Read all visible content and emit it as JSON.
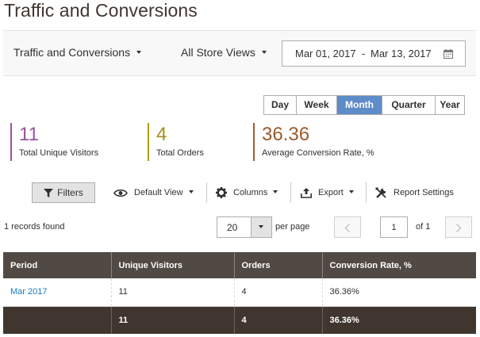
{
  "page": {
    "title": "Traffic and Conversions"
  },
  "toolbar": {
    "report_select": "Traffic and Conversions",
    "store_select": "All Store Views",
    "date_from": "Mar 01, 2017",
    "date_separator": "-",
    "date_to": "Mar 13, 2017"
  },
  "period_tabs": [
    {
      "label": "Day",
      "active": false
    },
    {
      "label": "Week",
      "active": false
    },
    {
      "label": "Month",
      "active": true
    },
    {
      "label": "Quarter",
      "active": false
    },
    {
      "label": "Year",
      "active": false
    }
  ],
  "metrics": [
    {
      "value": "11",
      "label": "Total Unique Visitors",
      "color": "#9a53a0"
    },
    {
      "value": "4",
      "label": "Total Orders",
      "color": "#b29c14"
    },
    {
      "value": "36.36",
      "label": "Average Conversion Rate, %",
      "color": "#a35a2c"
    }
  ],
  "grid_toolbar": {
    "filters": "Filters",
    "default_view": "Default View",
    "columns": "Columns",
    "export": "Export",
    "report_settings": "Report Settings"
  },
  "pager": {
    "records_found": "1 records found",
    "per_page_value": "20",
    "per_page_label": "per page",
    "current_page": "1",
    "of_pages": "of 1"
  },
  "table": {
    "headers": [
      "Period",
      "Unique Visitors",
      "Orders",
      "Conversion Rate, %"
    ],
    "rows": [
      [
        "Mar 2017",
        "11",
        "4",
        "36.36%"
      ]
    ],
    "totals": [
      "",
      "11",
      "4",
      "36.36%"
    ]
  },
  "colors": {
    "accent": "#5d8cc8",
    "table_header": "#514943",
    "table_totals": "#41362f",
    "link": "#1979c3"
  }
}
